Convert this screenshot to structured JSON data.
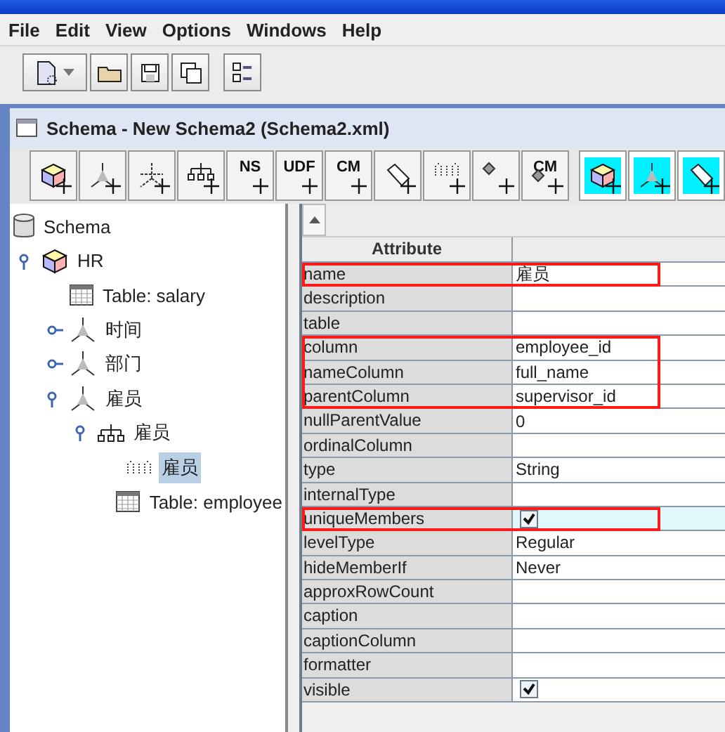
{
  "menu": [
    "File",
    "Edit",
    "View",
    "Options",
    "Windows",
    "Help"
  ],
  "main_toolbar": [
    {
      "kind": "new"
    },
    {
      "kind": "open"
    },
    {
      "kind": "save"
    },
    {
      "kind": "saveas"
    },
    {
      "kind": "prefs"
    }
  ],
  "frame": {
    "title": "Schema - New Schema2 (Schema2.xml)"
  },
  "schema_toolbar": [
    {
      "kind": "cube",
      "highlighted": false
    },
    {
      "kind": "dimension",
      "highlighted": false
    },
    {
      "kind": "usage",
      "highlighted": false
    },
    {
      "kind": "hierarchy",
      "highlighted": false
    },
    {
      "kind": "text",
      "label": "NS",
      "highlighted": false
    },
    {
      "kind": "text",
      "label": "UDF",
      "highlighted": false
    },
    {
      "kind": "text",
      "label": "CM",
      "highlighted": false
    },
    {
      "kind": "tag",
      "highlighted": false
    },
    {
      "kind": "level",
      "highlighted": false
    },
    {
      "kind": "diamond",
      "highlighted": false
    },
    {
      "kind": "diamond",
      "label": "CM",
      "highlighted": false
    },
    {
      "kind": "cube",
      "highlighted": true
    },
    {
      "kind": "dimension",
      "highlighted": true
    },
    {
      "kind": "tag",
      "highlighted": true
    }
  ],
  "tree": [
    {
      "label": "Schema",
      "kind": "schema",
      "selected": false,
      "children": [
        {
          "label": "HR",
          "kind": "cube",
          "selected": false,
          "expanded": true,
          "children": [
            {
              "label": "Table: salary",
              "kind": "table",
              "selected": false
            },
            {
              "label": "时间",
              "kind": "dimension",
              "selected": false,
              "expanded": false
            },
            {
              "label": "部门",
              "kind": "dimension",
              "selected": false,
              "expanded": false
            },
            {
              "label": "雇员",
              "kind": "dimension",
              "selected": false,
              "expanded": true,
              "children": [
                {
                  "label": "雇员",
                  "kind": "hierarchy",
                  "selected": false,
                  "expanded": true,
                  "children": [
                    {
                      "label": "雇员",
                      "kind": "level",
                      "selected": true
                    },
                    {
                      "label": "Table: employee",
                      "kind": "table",
                      "selected": false
                    }
                  ]
                }
              ]
            }
          ]
        }
      ]
    }
  ],
  "table": {
    "columns": [
      "Attribute"
    ],
    "rows": [
      {
        "name": "name",
        "kind": "text",
        "value": "雇员",
        "highlighted": true,
        "selected": false
      },
      {
        "name": "description",
        "kind": "text",
        "value": "",
        "highlighted": false,
        "selected": false
      },
      {
        "name": "table",
        "kind": "text",
        "value": "",
        "highlighted": false,
        "selected": false
      },
      {
        "name": "column",
        "kind": "text",
        "value": "employee_id",
        "highlighted": true,
        "selected": false
      },
      {
        "name": "nameColumn",
        "kind": "text",
        "value": "full_name",
        "highlighted": true,
        "selected": false
      },
      {
        "name": "parentColumn",
        "kind": "text",
        "value": "supervisor_id",
        "highlighted": true,
        "selected": false
      },
      {
        "name": "nullParentValue",
        "kind": "text",
        "value": "0",
        "highlighted": false,
        "selected": false
      },
      {
        "name": "ordinalColumn",
        "kind": "text",
        "value": "",
        "highlighted": false,
        "selected": false
      },
      {
        "name": "type",
        "kind": "text",
        "value": "String",
        "highlighted": false,
        "selected": false
      },
      {
        "name": "internalType",
        "kind": "text",
        "value": "",
        "highlighted": false,
        "selected": false
      },
      {
        "name": "uniqueMembers",
        "kind": "checkbox",
        "checked": true,
        "highlighted": true,
        "selected": true
      },
      {
        "name": "levelType",
        "kind": "text",
        "value": "Regular",
        "highlighted": false,
        "selected": false
      },
      {
        "name": "hideMemberIf",
        "kind": "text",
        "value": "Never",
        "highlighted": false,
        "selected": false
      },
      {
        "name": "approxRowCount",
        "kind": "text",
        "value": "",
        "highlighted": false,
        "selected": false
      },
      {
        "name": "caption",
        "kind": "text",
        "value": "",
        "highlighted": false,
        "selected": false
      },
      {
        "name": "captionColumn",
        "kind": "text",
        "value": "",
        "highlighted": false,
        "selected": false
      },
      {
        "name": "formatter",
        "kind": "text",
        "value": "",
        "highlighted": false,
        "selected": false
      },
      {
        "name": "visible",
        "kind": "checkbox",
        "checked": true,
        "highlighted": false,
        "selected": false
      }
    ]
  }
}
